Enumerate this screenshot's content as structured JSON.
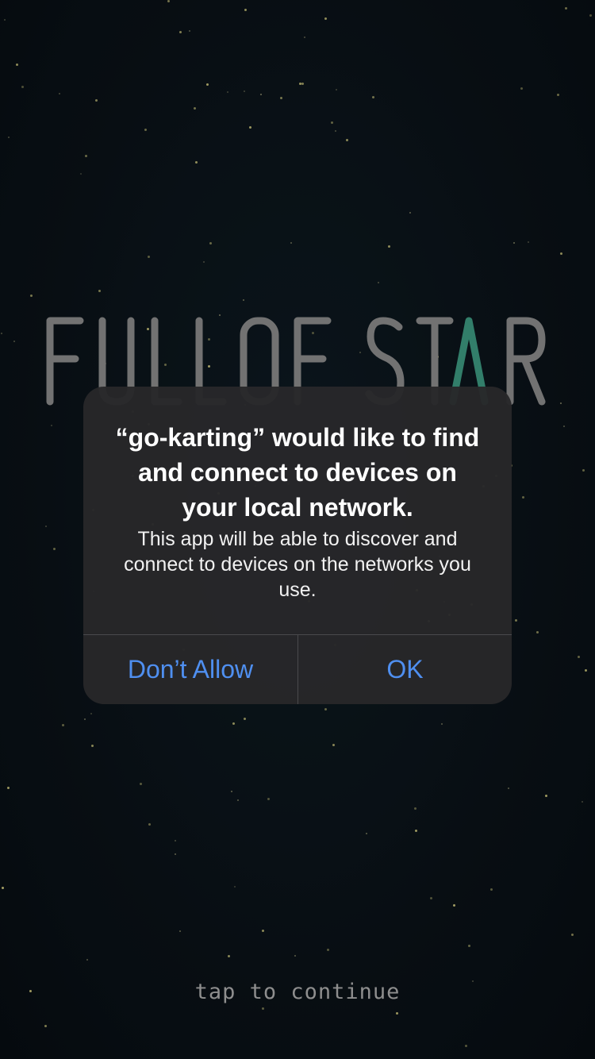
{
  "game": {
    "logo_text": "FULL OF STARS",
    "footer_prompt": "tap to continue",
    "colors": {
      "background": "#0b141b",
      "logo_gray": "#8c8c8c",
      "logo_accent": "#3e9a82",
      "star": "#c8c27a"
    }
  },
  "alert": {
    "title": "“go-karting” would like to find and connect to devices on your local network.",
    "message": "This app will be able to discover and connect to devices on the networks you use.",
    "buttons": {
      "deny_label": "Don’t Allow",
      "ok_label": "OK"
    },
    "colors": {
      "background": "#28282a",
      "text": "#ffffff",
      "button_text": "#4f8ff0",
      "divider": "#4a4a4d"
    }
  }
}
